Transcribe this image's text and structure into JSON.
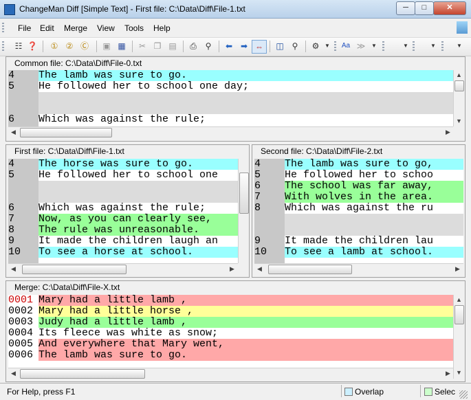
{
  "window": {
    "title": "ChangeMan Diff [Simple Text] - First file: C:\\Data\\Diff\\File-1.txt"
  },
  "menu": {
    "items": [
      "File",
      "Edit",
      "Merge",
      "View",
      "Tools",
      "Help"
    ]
  },
  "common_pane": {
    "label": "Common file: C:\\Data\\Diff\\File-0.txt",
    "lines": [
      {
        "num": "4",
        "text": "The lamb was sure to go.",
        "color": "cyan"
      },
      {
        "num": "5",
        "text": "He followed her to school one day;",
        "color": "white"
      },
      {
        "num": "",
        "text": "",
        "color": "grey"
      },
      {
        "num": "",
        "text": "",
        "color": "grey"
      },
      {
        "num": "6",
        "text": "Which was against the rule;",
        "color": "white"
      }
    ]
  },
  "first_pane": {
    "label": "First file: C:\\Data\\Diff\\File-1.txt",
    "lines": [
      {
        "num": "4",
        "text": "The horse was sure to go.",
        "color": "cyan"
      },
      {
        "num": "5",
        "text": "He followed her to school one",
        "color": "white"
      },
      {
        "num": "",
        "text": "",
        "color": "grey"
      },
      {
        "num": "",
        "text": "",
        "color": "grey"
      },
      {
        "num": "6",
        "text": "Which was against the rule;",
        "color": "white"
      },
      {
        "num": "7",
        "text": "Now, as you can clearly see,",
        "color": "green"
      },
      {
        "num": "8",
        "text": "The rule was unreasonable.",
        "color": "green"
      },
      {
        "num": "9",
        "text": "It made the children laugh an",
        "color": "white"
      },
      {
        "num": "10",
        "text": "To see a horse at school.",
        "color": "cyan"
      }
    ]
  },
  "second_pane": {
    "label": "Second file: C:\\Data\\Diff\\File-2.txt",
    "lines": [
      {
        "num": "4",
        "text": "The lamb was sure to go,",
        "color": "cyan"
      },
      {
        "num": "5",
        "text": "He followed her to schoo",
        "color": "white"
      },
      {
        "num": "6",
        "text": "The school was far away,",
        "color": "green"
      },
      {
        "num": "7",
        "text": "With wolves in the area.",
        "color": "green"
      },
      {
        "num": "8",
        "text": "Which was against the ru",
        "color": "white"
      },
      {
        "num": "",
        "text": "",
        "color": "grey"
      },
      {
        "num": "",
        "text": "",
        "color": "grey"
      },
      {
        "num": "9",
        "text": "It made the children lau",
        "color": "white"
      },
      {
        "num": "10",
        "text": "To see a lamb at school.",
        "color": "cyan"
      }
    ]
  },
  "merge_pane": {
    "label": "Merge: C:\\Data\\Diff\\File-X.txt",
    "lines": [
      {
        "num": "0001",
        "text": "Mary had a little lamb ,",
        "color": "salmon",
        "current": true
      },
      {
        "num": "0002",
        "text": "Mary had a little horse ,",
        "color": "yellow",
        "current": false
      },
      {
        "num": "0003",
        "text": "Judy had a little lamb ,",
        "color": "green",
        "current": false
      },
      {
        "num": "0004",
        "text": "Its fleece was white as snow;",
        "color": "white",
        "current": false
      },
      {
        "num": "0005",
        "text": "And everywhere that Mary went,",
        "color": "salmon",
        "current": false
      },
      {
        "num": "0006",
        "text": "The lamb was sure to go.",
        "color": "salmon",
        "current": false
      }
    ]
  },
  "status": {
    "help": "For Help, press F1",
    "overlap": "Overlap",
    "select": "Selec"
  },
  "colors": {
    "cyan": "#99ffff",
    "green": "#99ff99",
    "grey": "#dcdcdc",
    "salmon": "#ffa8a8",
    "yellow": "#ffff99",
    "white": "#ffffff"
  }
}
